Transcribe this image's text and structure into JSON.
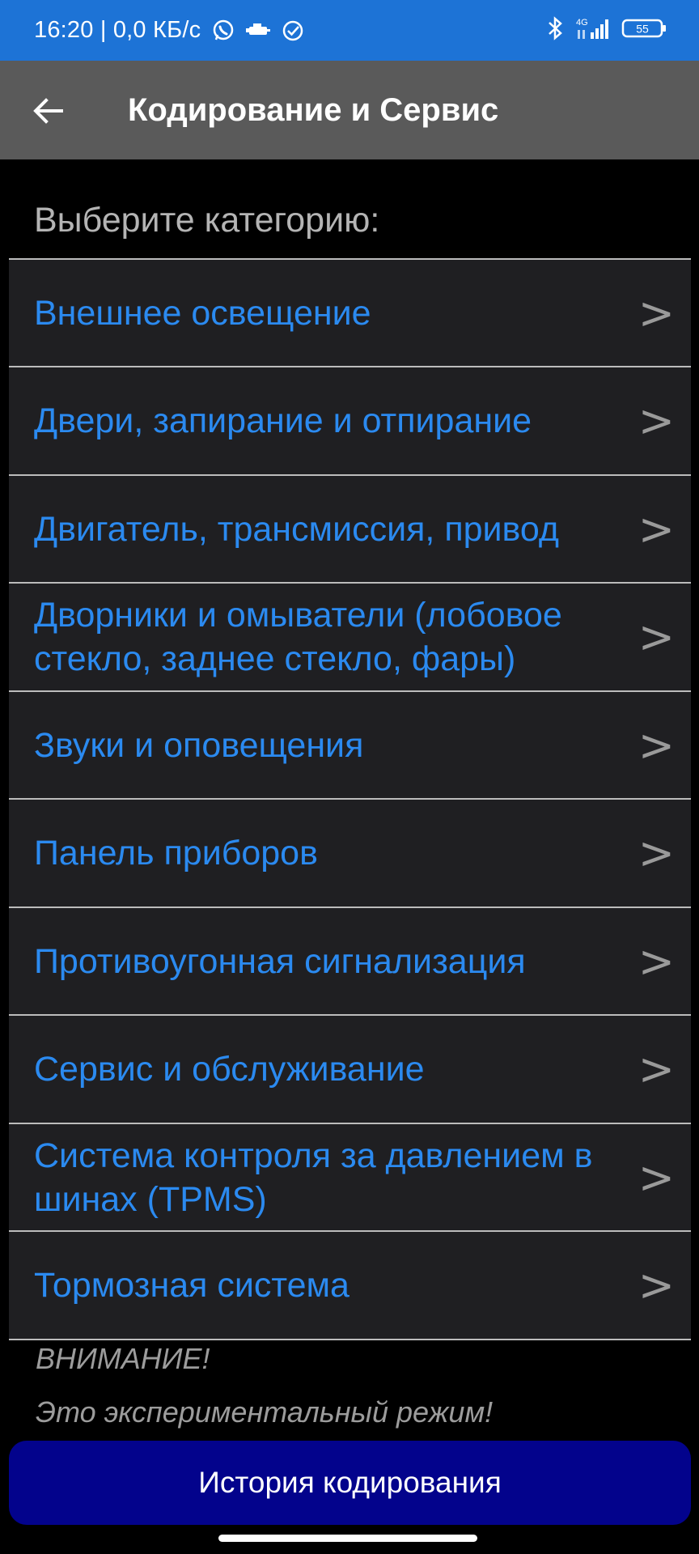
{
  "status_bar": {
    "time_speed": "16:20 | 0,0 КБ/с",
    "network": "4G",
    "battery": "55",
    "icons": [
      "whatsapp-icon",
      "car-icon",
      "check-circle-icon",
      "bluetooth-icon",
      "signal-icon",
      "battery-icon"
    ]
  },
  "app_bar": {
    "title": "Кодирование и Сервис"
  },
  "subtitle": "Выберите категорию:",
  "categories": [
    {
      "label": "Внешнее освещение"
    },
    {
      "label": "Двери, запирание и отпирание"
    },
    {
      "label": "Двигатель, трансмиссия, привод"
    },
    {
      "label": "Дворники и омыватели (лобовое стекло, заднее стекло, фары)"
    },
    {
      "label": "Звуки и оповещения"
    },
    {
      "label": "Панель приборов"
    },
    {
      "label": "Противоугонная сигнализация"
    },
    {
      "label": "Сервис и обслуживание"
    },
    {
      "label": "Система контроля за давлением в шинах (TPMS)"
    },
    {
      "label": "Тормозная система"
    }
  ],
  "chevron": ">",
  "warning": {
    "title": "ВНИМАНИЕ!",
    "text": "Это экспериментальный режим!"
  },
  "history_button": "История кодирования",
  "colors": {
    "status_bar": "#1d73d6",
    "app_bar": "#5a5a5a",
    "link": "#2b8af0",
    "button": "#03038c"
  }
}
